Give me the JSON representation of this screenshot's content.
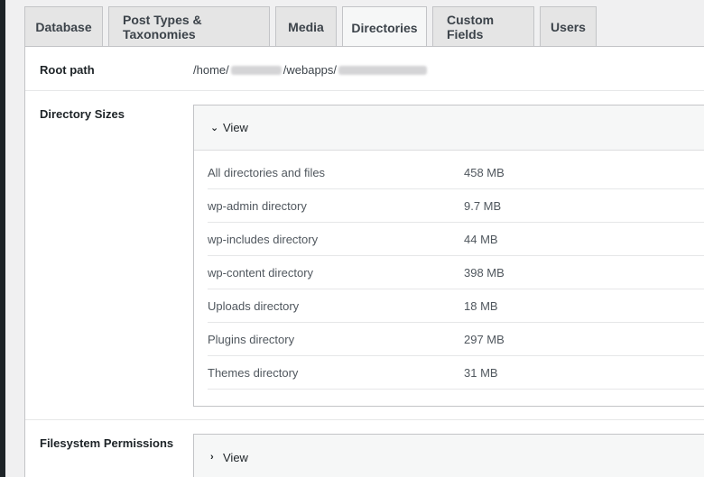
{
  "tabs": [
    {
      "label": "Database"
    },
    {
      "label": "Post Types & Taxonomies"
    },
    {
      "label": "Media"
    },
    {
      "label": "Directories",
      "active": true
    },
    {
      "label": "Custom Fields"
    },
    {
      "label": "Users"
    }
  ],
  "root_path": {
    "label": "Root path",
    "prefix": "/home/",
    "middle": "/webapps/"
  },
  "directory_sizes": {
    "label": "Directory Sizes",
    "toggle_label": "View",
    "rows": [
      {
        "name": "All directories and files",
        "size": "458 MB"
      },
      {
        "name": "wp-admin directory",
        "size": "9.7 MB"
      },
      {
        "name": "wp-includes directory",
        "size": "44 MB"
      },
      {
        "name": "wp-content directory",
        "size": "398 MB"
      },
      {
        "name": "Uploads directory",
        "size": "18 MB"
      },
      {
        "name": "Plugins directory",
        "size": "297 MB"
      },
      {
        "name": "Themes directory",
        "size": "31 MB"
      }
    ]
  },
  "filesystem_permissions": {
    "label": "Filesystem Permissions",
    "toggle_label": "View"
  },
  "colors": {
    "page_bg": "#f0f0f1",
    "tab_bg": "#e5e5e5",
    "active_tab_bg": "#f6f7f7",
    "border": "#c3c4c7"
  },
  "icons": {
    "expanded": "chevron-down-icon",
    "collapsed": "chevron-right-icon"
  }
}
